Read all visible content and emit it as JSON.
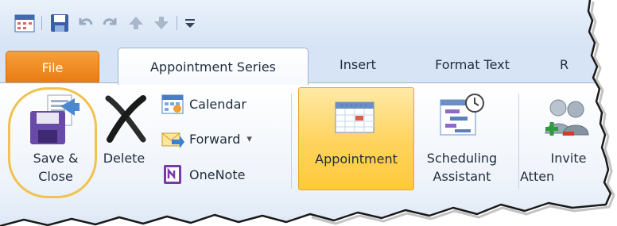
{
  "qat": {
    "icons": [
      "calendar-icon",
      "save-icon",
      "undo-icon",
      "redo-icon",
      "previous-item-icon",
      "next-item-icon",
      "customize-qat-icon"
    ]
  },
  "tabs": {
    "file": "File",
    "appointment_series": "Appointment Series",
    "insert": "Insert",
    "format_text": "Format Text",
    "review_partial": "R"
  },
  "ribbon": {
    "save_close_line1": "Save &",
    "save_close_line2": "Close",
    "delete": "Delete",
    "calendar": "Calendar",
    "forward": "Forward",
    "forward_arrow": "▾",
    "onenote": "OneNote",
    "appointment": "Appointment",
    "scheduling_line1": "Scheduling",
    "scheduling_line2": "Assistant",
    "invite_line1": "Invite",
    "invite_line2": "Atten"
  },
  "colors": {
    "file_tab": "#e97a12",
    "active_button": "#ffd35c",
    "highlight_ring": "#f2c14e"
  }
}
